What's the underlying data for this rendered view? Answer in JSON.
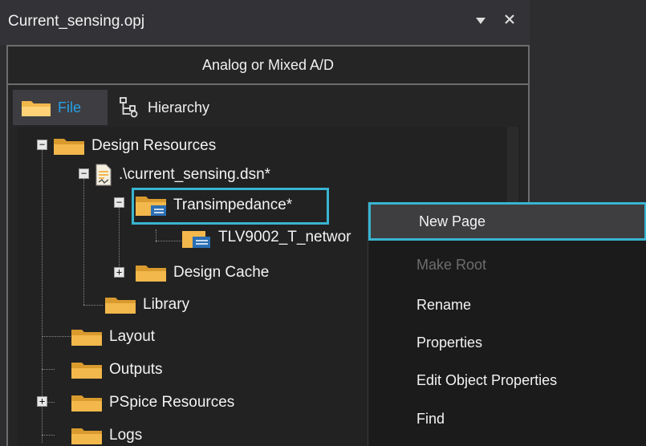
{
  "window": {
    "title": "Current_sensing.opj",
    "dropdown_icon": "triangle-down-icon",
    "close_icon": "close-icon"
  },
  "mode": {
    "label": "Analog or Mixed A/D"
  },
  "tabs": [
    {
      "label": "File",
      "icon": "folder-icon",
      "active": true
    },
    {
      "label": "Hierarchy",
      "icon": "hierarchy-icon",
      "active": false
    }
  ],
  "tree": {
    "design_resources": "Design Resources",
    "design_file": ".\\current_sensing.dsn*",
    "schematic": "Transimpedance*",
    "page": "TLV9002_T_networ",
    "design_cache": "Design Cache",
    "library": "Library",
    "layout": "Layout",
    "outputs": "Outputs",
    "pspice_resources": "PSpice Resources",
    "logs": "Logs"
  },
  "context_menu": {
    "items": [
      {
        "label": "New Page",
        "enabled": true,
        "highlighted": true
      },
      {
        "label": "Make Root",
        "enabled": false,
        "highlighted": false
      },
      {
        "label": "Rename",
        "enabled": true,
        "highlighted": false
      },
      {
        "label": "Properties",
        "enabled": true,
        "highlighted": false
      },
      {
        "label": "Edit Object Properties",
        "enabled": true,
        "highlighted": false
      },
      {
        "label": "Find",
        "enabled": true,
        "highlighted": false
      }
    ]
  },
  "colors": {
    "accent": "#38b4d0",
    "tab_active_text": "#28a0e6",
    "folder": "#f2b84c",
    "background": "#2d2d30"
  }
}
